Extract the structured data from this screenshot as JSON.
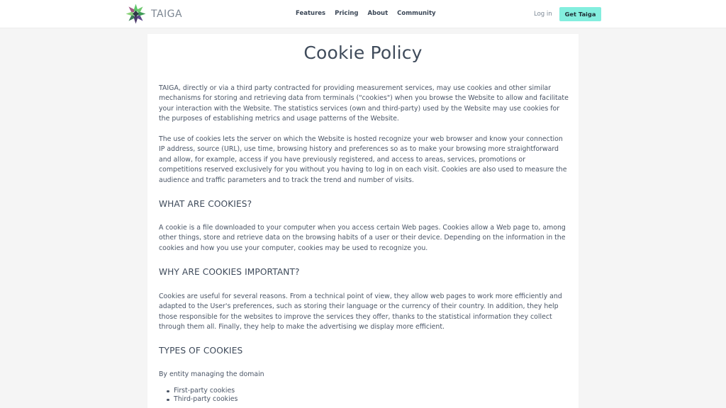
{
  "header": {
    "logo_text": "TAIGA",
    "nav": [
      "Features",
      "Pricing",
      "About",
      "Community"
    ],
    "login_label": "Log in",
    "cta_label": "Get Taiga"
  },
  "colors": {
    "accent": "#83eede",
    "logo_green": "#5dc66a",
    "logo_purple": "#6a4a8a",
    "page_bg": "#f5f5f5"
  },
  "page": {
    "title": "Cookie Policy",
    "intro_1": "TAIGA, directly or via a third party contracted for providing measurement services, may use cookies and other similar mechanisms for storing and retrieving data from terminals (\"cookies\") when you browse the Website to allow and facilitate your interaction with the Website. The statistics services (own and third-party) used by the Website may use cookies for the purposes of establishing metrics and usage patterns of the Website.",
    "intro_2": "The use of cookies lets the server on which the Website is hosted recognize your web browser and know your connection IP address, source (URL), use time, browsing history and preferences so as to make your browsing more straightforward and allow, for example, access if you have previously registered, and access to areas, services, promotions or competitions reserved exclusively for you without you having to log in on each visit. Cookies are also used to measure the audience and traffic parameters and to track the trend and number of visits.",
    "what_heading": "WHAT ARE COOKIES?",
    "what_text": "A cookie is a file downloaded to your computer when you access certain Web pages. Cookies allow a Web page to, among other things, store and retrieve data on the browsing habits of a user or their device. Depending on the information in the cookies and how you use your computer, cookies may be used to recognize you.",
    "why_heading": "WHY ARE COOKIES IMPORTANT?",
    "why_text": "Cookies are useful for several reasons. From a technical point of view, they allow web pages to work more efficiently and adapted to the User's preferences, such as storing their language or the currency of their country. In addition, they help those responsible for the websites to improve the services they offer, thanks to the statistical information they collect through them all. Finally, they help to make the advertising we display more efficient.",
    "types_heading": "TYPES OF COOKIES",
    "entity_label": "By entity managing the domain",
    "entity_list": [
      "First-party cookies",
      "Third-party cookies"
    ]
  }
}
